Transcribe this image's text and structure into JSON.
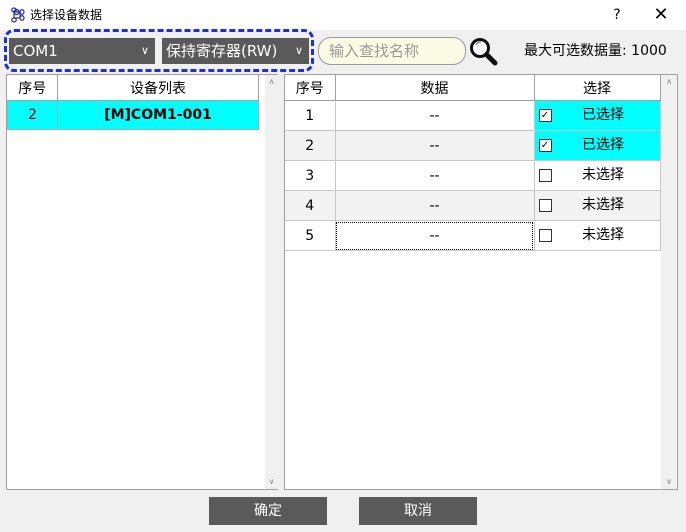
{
  "window": {
    "title": "选择设备数据",
    "help_label": "?",
    "close_label": "✕",
    "icon": "command-icon"
  },
  "toolbar": {
    "port_select": "COM1",
    "register_select": "保持寄存器(RW)",
    "search_placeholder": "输入查找名称",
    "search_value": "",
    "max_label": "最大可选数据量:",
    "max_value": "1000"
  },
  "device_table": {
    "headers": [
      "序号",
      "设备列表"
    ],
    "rows": [
      {
        "index": "2",
        "name": "[M]COM1-001"
      }
    ]
  },
  "data_table": {
    "headers": [
      "序号",
      "数据",
      "选择"
    ],
    "rows": [
      {
        "index": "1",
        "data": "--",
        "checked": true,
        "status": "已选择"
      },
      {
        "index": "2",
        "data": "--",
        "checked": true,
        "status": "已选择"
      },
      {
        "index": "3",
        "data": "--",
        "checked": false,
        "status": "未选择"
      },
      {
        "index": "4",
        "data": "--",
        "checked": false,
        "status": "未选择"
      },
      {
        "index": "5",
        "data": "--",
        "checked": false,
        "status": "未选择"
      }
    ]
  },
  "buttons": {
    "ok": "确定",
    "cancel": "取消"
  },
  "colors": {
    "selected_row": "#00ffff",
    "button_bg": "#5a5a5a",
    "highlight_border": "#1e2fd6",
    "search_bg": "#fafbe5"
  }
}
